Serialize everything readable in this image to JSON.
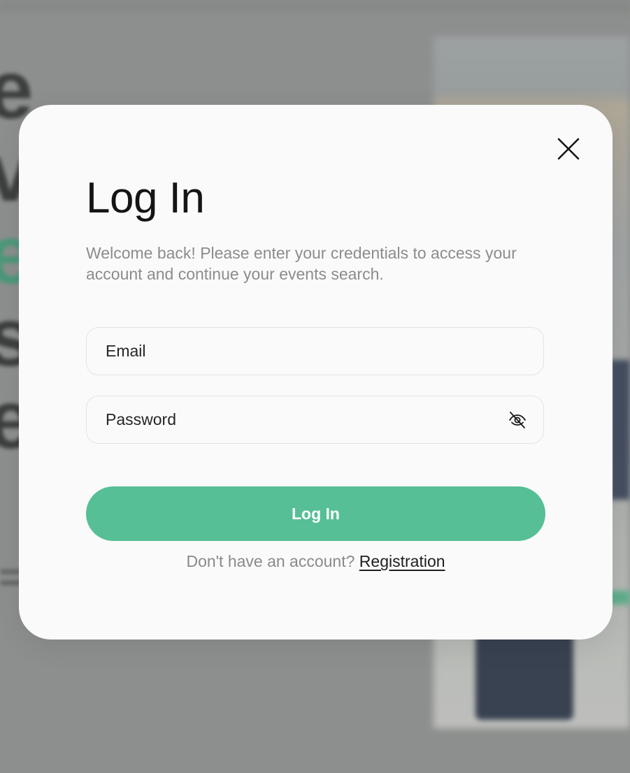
{
  "background": {
    "hero_text_lines": [
      "e",
      "v",
      "e",
      "s",
      "e"
    ]
  },
  "modal": {
    "close_icon": "close-icon",
    "title": "Log In",
    "subtitle": "Welcome back! Please enter your credentials to access your account and continue your events search.",
    "email": {
      "placeholder": "Email",
      "value": ""
    },
    "password": {
      "placeholder": "Password",
      "value": "",
      "toggle_icon": "eye-off-icon"
    },
    "submit_label": "Log In",
    "signup_prompt": "Don't have an account?",
    "signup_link": "Registration"
  },
  "colors": {
    "accent": "#56bf95",
    "title": "#151515",
    "muted_text": "#8c8c8c",
    "modal_bg": "#fafafa",
    "overlay": "#8f9190"
  }
}
